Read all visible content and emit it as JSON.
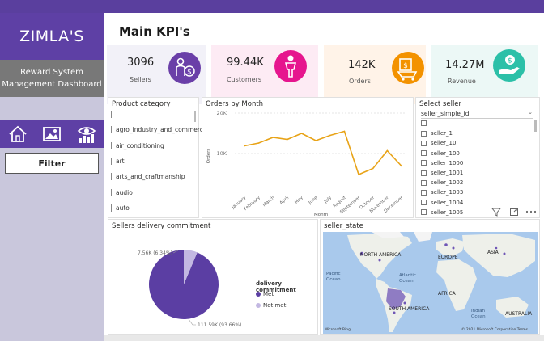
{
  "sidebar": {
    "brand": "ZIMLA'S",
    "title_line1": "Reward System",
    "title_line2": "Management Dashboard",
    "filter_label": "Filter",
    "nav_icons": [
      "home-icon",
      "image-icon",
      "eye-chart-icon"
    ]
  },
  "header": {
    "title": "Main KPI's"
  },
  "kpis": [
    {
      "value": "3096",
      "label": "Sellers",
      "bg": "#f2f1f8",
      "circle": "#6a3fa8",
      "icon": "person-dollar-icon"
    },
    {
      "value": "99.44K",
      "label": "Customers",
      "bg": "#fdebf4",
      "circle": "#e6158e",
      "icon": "person-icon"
    },
    {
      "value": "142K",
      "label": "Orders",
      "bg": "#fff3e8",
      "circle": "#f39200",
      "icon": "cart-icon"
    },
    {
      "value": "14.27M",
      "label": "Revenue",
      "bg": "#ecf8f6",
      "circle": "#2cc0a8",
      "icon": "hand-dollar-icon"
    }
  ],
  "product_category": {
    "title": "Product category",
    "items": [
      "",
      "agro_industry_and_commerce",
      "air_conditioning",
      "art",
      "arts_and_craftmanship",
      "audio",
      "auto"
    ]
  },
  "orders_by_month": {
    "title": "Orders by Month",
    "y_axis_label": "Orders",
    "x_axis_label": "Month",
    "y_ticks": [
      "20K",
      "10K"
    ]
  },
  "chart_data": {
    "type": "line",
    "title": "Orders by Month",
    "xlabel": "Month",
    "ylabel": "Orders",
    "categories": [
      "January",
      "February",
      "March",
      "April",
      "May",
      "June",
      "July",
      "August",
      "September",
      "October",
      "November",
      "December"
    ],
    "values": [
      11900,
      12600,
      14000,
      13500,
      15000,
      13200,
      14500,
      15500,
      4800,
      6300,
      10700,
      6900
    ],
    "ylim": [
      0,
      20000
    ],
    "color": "#e8a317"
  },
  "select_seller": {
    "title": "Select seller",
    "field": "seller_simple_id",
    "items": [
      "",
      "seller_1",
      "seller_10",
      "seller_100",
      "seller_1000",
      "seller_1001",
      "seller_1002",
      "seller_1003",
      "seller_1004",
      "seller_1005"
    ]
  },
  "delivery": {
    "title": "Sellers delivery commitment",
    "legend_title": "delivery commitment",
    "met_label": "Met",
    "notmet_label": "Not met",
    "met_value_label": "111.59K (93.66%)",
    "notmet_value_label": "7.56K (6.34%)",
    "met_color": "#5b3ea3",
    "notmet_color": "#c3b8e2",
    "met_pct": 93.66
  },
  "map": {
    "title": "seller_state",
    "labels": {
      "north_america": "NORTH AMERICA",
      "europe": "EUROPE",
      "asia": "ASIA",
      "pacific": "Pacific",
      "pacific2": "Ocean",
      "atlantic": "Atlantic",
      "atlantic2": "Ocean",
      "africa": "AFRICA",
      "south_america": "SOUTH AMERICA",
      "indian": "Indian",
      "indian2": "Ocean",
      "australia": "AUSTRALIA"
    },
    "provider": "Microsoft Bing",
    "copyright": "© 2021 Microsoft Corporation Terms"
  }
}
